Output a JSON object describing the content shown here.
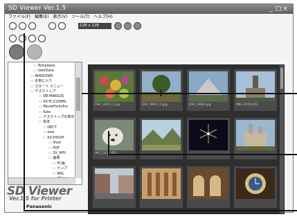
{
  "window": {
    "title": "SD Viewer Ver.1.5",
    "controls": [
      "_",
      "□",
      "×"
    ]
  },
  "menu": [
    "ファイル(F)",
    "編集(E)",
    "表示(V)",
    "ツール(T)",
    "ヘルプ(H)"
  ],
  "toolbar": {
    "size_select": "128 x 128"
  },
  "tree": [
    "Templates",
    "UserData",
    "WINDOWS",
    "お気に入り",
    "スタート メニュー",
    "デスクトップ",
    "DR-MA6SUS",
    "KX-TC2100ML",
    "MovieFontsFor",
    "fuke",
    "デスクトップの表示",
    "松本",
    "DECT",
    "eizo",
    "KX-PX0XP",
    "illust",
    "PDF",
    "SV_APII",
    "画像",
    "PC画",
    "インプ",
    "IMG",
    "プリン"
  ],
  "gallery": [
    {
      "caption": "DSC_0010_1.jpg",
      "scene": "flowers"
    },
    {
      "caption": "DSC_0010_1.jpg",
      "scene": "tree"
    },
    {
      "caption": "DSC_0008.jpg",
      "scene": "building"
    },
    {
      "caption": "IMG_0010.JPG",
      "scene": "tower"
    },
    {
      "caption": "IMG_0020.JPG",
      "scene": "dog"
    },
    {
      "caption": "",
      "scene": "valley"
    },
    {
      "caption": "",
      "scene": "fireworks"
    },
    {
      "caption": "",
      "scene": "castle"
    },
    {
      "caption": "",
      "scene": "street"
    },
    {
      "caption": "",
      "scene": "cathedral"
    },
    {
      "caption": "",
      "scene": "arches"
    },
    {
      "caption": "",
      "scene": "clock"
    }
  ],
  "logo": {
    "line1": "SD Viewer",
    "line2": "Ver.1.5 for Printer",
    "brand": "Panasonic"
  },
  "colors": {
    "titlebar": "#6e6e6e",
    "gallery_bg": "#2f2f2f"
  }
}
